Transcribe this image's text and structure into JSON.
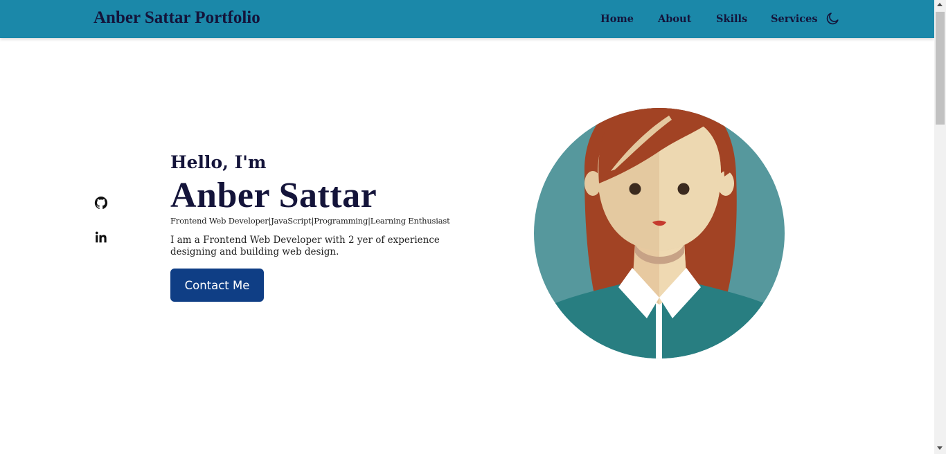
{
  "header": {
    "logo": "Anber Sattar Portfolio",
    "nav": [
      {
        "label": "Home"
      },
      {
        "label": "About"
      },
      {
        "label": "Skills"
      },
      {
        "label": "Services"
      }
    ],
    "theme_toggle_icon": "moon-icon",
    "background_color": "#1b88a9"
  },
  "social": [
    {
      "icon": "github-icon"
    },
    {
      "icon": "linkedin-icon"
    }
  ],
  "hero": {
    "greeting": "Hello, I'm",
    "name": "Anber Sattar",
    "subtitle": "Frontend Web Developer|JavaScript|Programming|Learning Enthusiast",
    "description": "I am a Frontend Web Developer with 2 yer of experience designing and building web design.",
    "contact_label": "Contact Me",
    "contact_color": "#0f3e85"
  },
  "avatar": {
    "icon": "woman-avatar-illustration",
    "circle_color": "#56989d"
  }
}
